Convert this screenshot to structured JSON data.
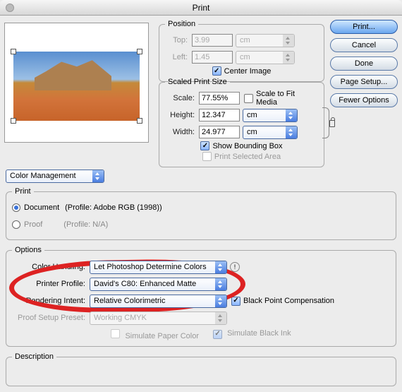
{
  "title": "Print",
  "buttons": {
    "print": "Print...",
    "cancel": "Cancel",
    "done": "Done",
    "page_setup": "Page Setup...",
    "fewer_options": "Fewer Options"
  },
  "position": {
    "legend": "Position",
    "top_label": "Top:",
    "top_value": "3.99",
    "top_unit": "cm",
    "left_label": "Left:",
    "left_value": "1.45",
    "left_unit": "cm",
    "center_label": "Center Image"
  },
  "scaled": {
    "legend": "Scaled Print Size",
    "scale_label": "Scale:",
    "scale_value": "77.55%",
    "fit_label": "Scale to Fit Media",
    "height_label": "Height:",
    "height_value": "12.347",
    "height_unit": "cm",
    "width_label": "Width:",
    "width_value": "24.977",
    "width_unit": "cm",
    "bbox_label": "Show Bounding Box",
    "selarea_label": "Print Selected Area"
  },
  "colormgmt": {
    "select": "Color Management",
    "print_legend": "Print",
    "doc_label": "Document",
    "doc_profile": "(Profile: Adobe RGB (1998))",
    "proof_label": "Proof",
    "proof_profile": "(Profile: N/A)",
    "options_legend": "Options",
    "handling_label": "Color Handling:",
    "handling_value": "Let Photoshop Determine Colors",
    "profile_label": "Printer Profile:",
    "profile_value": "David's C80: Enhanced Matte",
    "intent_label": "Rendering Intent:",
    "intent_value": "Relative Colorimetric",
    "bpc_label": "Black Point Compensation",
    "proof_preset_label": "Proof Setup Preset:",
    "proof_preset_value": "Working CMYK",
    "sim_paper": "Simulate Paper Color",
    "sim_black": "Simulate Black Ink",
    "desc_legend": "Description"
  }
}
